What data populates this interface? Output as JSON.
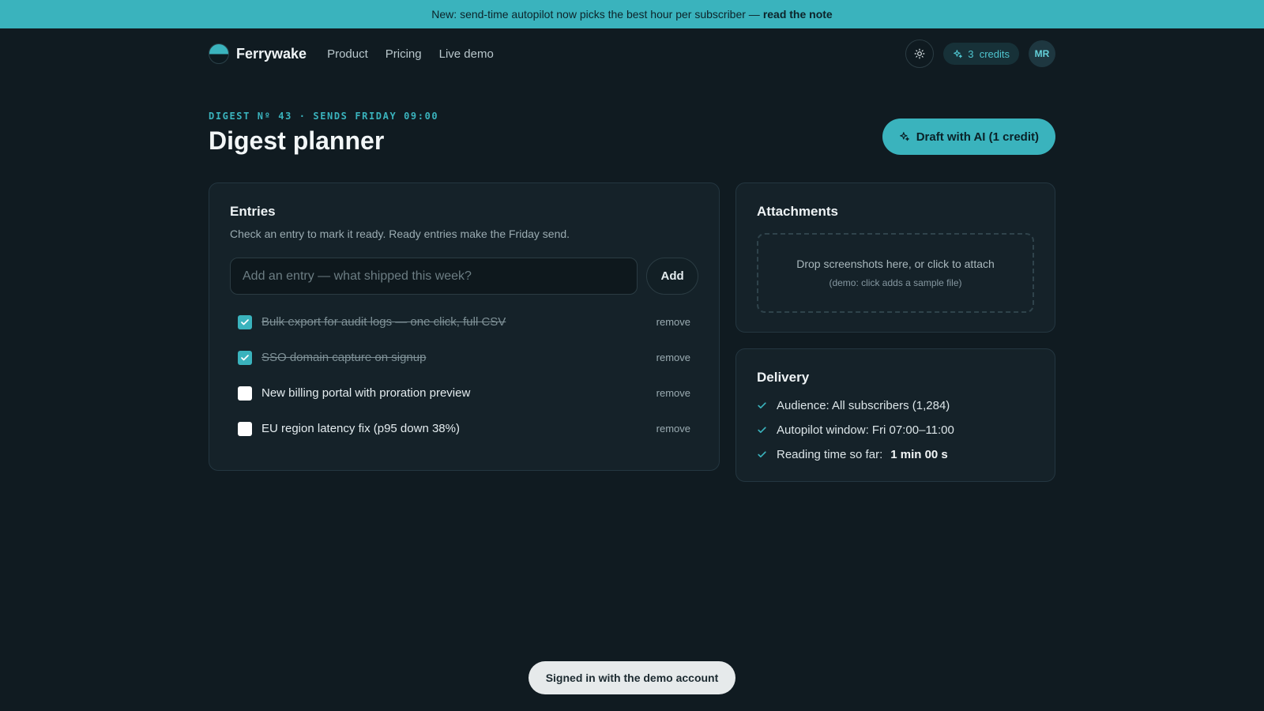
{
  "announcement": {
    "text": "New: send-time autopilot now picks the best hour per subscriber —",
    "link": "read the note"
  },
  "nav": {
    "brand": "Ferrywake",
    "links": [
      "Product",
      "Pricing",
      "Live demo"
    ],
    "credits": "3  credits",
    "avatar": "MR",
    "icons": {
      "theme": "sun-icon",
      "credits": "sparkle-icon"
    }
  },
  "header": {
    "eyebrow": "DIGEST Nº 43 · SENDS FRIDAY 09:00",
    "title": "Digest planner",
    "draft_button": "Draft with AI (1 credit)"
  },
  "entries": {
    "title": "Entries",
    "subtitle": "Check an entry to mark it ready. Ready entries make the Friday send.",
    "input_placeholder": "Add an entry — what shipped this week?",
    "add_label": "Add",
    "remove_label": "remove",
    "items": [
      {
        "text": "Bulk export for audit logs — one click, full CSV",
        "checked": true
      },
      {
        "text": "SSO domain capture on signup",
        "checked": true
      },
      {
        "text": "New billing portal with proration preview",
        "checked": false
      },
      {
        "text": "EU region latency fix (p95 down 38%)",
        "checked": false
      }
    ]
  },
  "attachments": {
    "title": "Attachments",
    "drop_text": "Drop screenshots here, or click to attach",
    "drop_hint": "(demo: click adds a sample file)"
  },
  "delivery": {
    "title": "Delivery",
    "items": [
      {
        "label": "Audience: All subscribers (1,284)"
      },
      {
        "label": "Autopilot window: Fri 07:00–11:00"
      },
      {
        "label": "Reading time so far:",
        "value": "1 min 00 s"
      }
    ]
  },
  "toast": "Signed in with the demo account",
  "colors": {
    "accent": "#3ab3bd",
    "background": "#101b21",
    "card": "#152229"
  }
}
